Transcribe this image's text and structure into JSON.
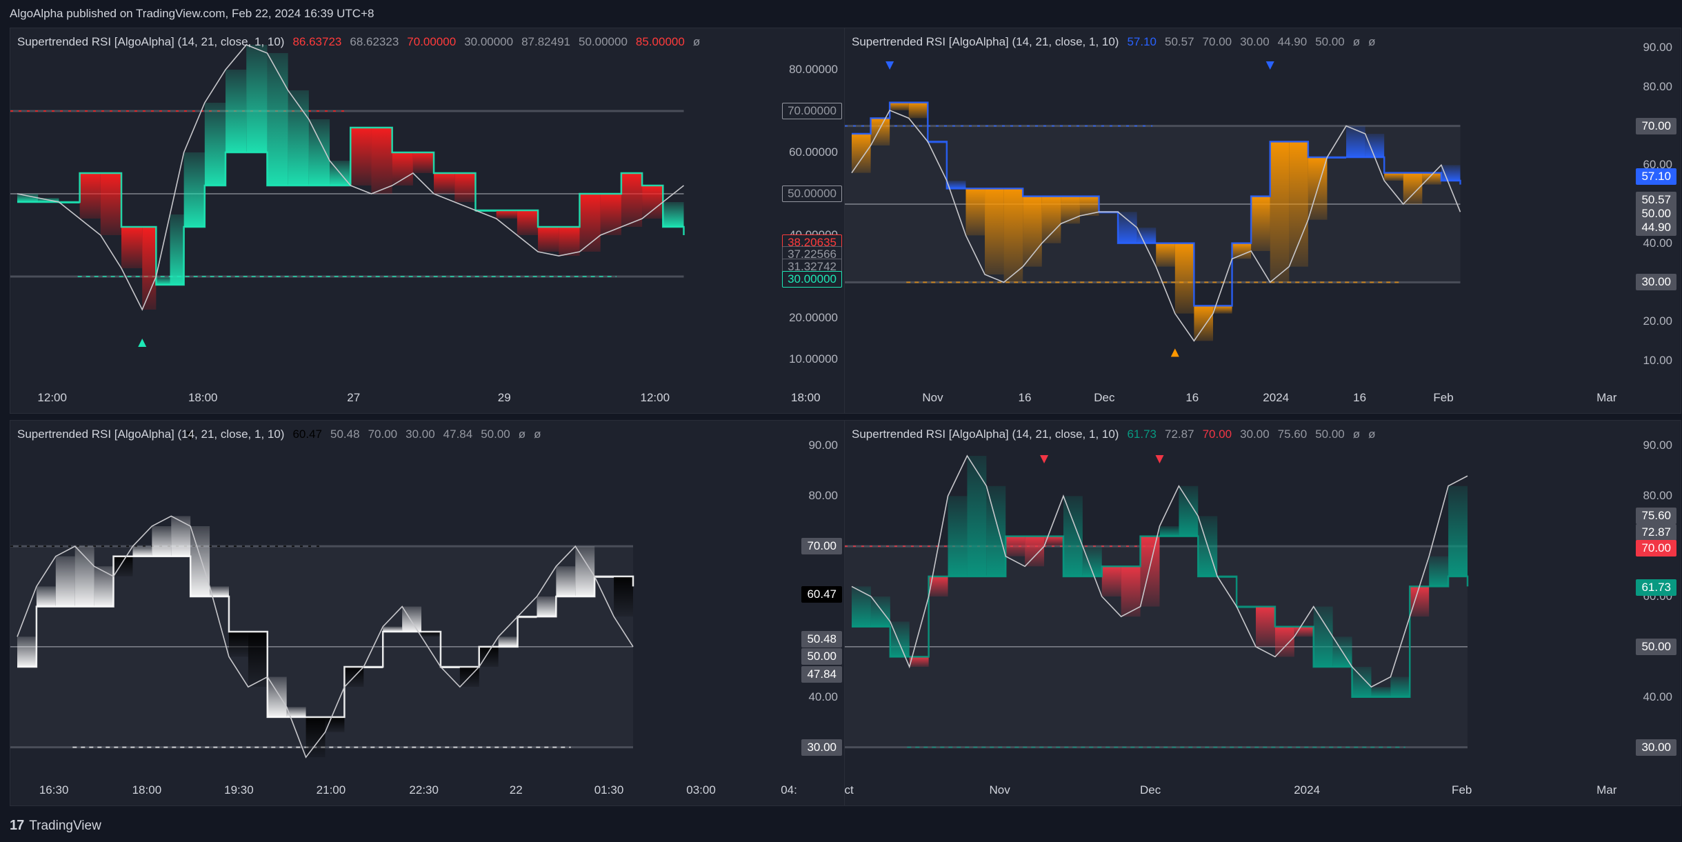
{
  "header": {
    "text": "AlgoAlpha published on TradingView.com, Feb 22, 2024 16:39 UTC+8"
  },
  "footer": {
    "brand": "TradingView",
    "logo_mark": "17"
  },
  "colors": {
    "bg": "#131722",
    "panel": "#1e222d",
    "teal": "#1de9b6",
    "red": "#ff1e1e",
    "blue": "#2962ff",
    "orange": "#ff9800",
    "white": "#ffffff",
    "crimson": "#f23645",
    "green": "#089981"
  },
  "panels": [
    {
      "id": "tl",
      "legend": [
        {
          "text": "Supertrended RSI [AlgoAlpha] (14, 21, close, 1, 10)",
          "color": "#d1d4dc"
        },
        {
          "text": "86.63723",
          "color": "#ff3b3b"
        },
        {
          "text": "68.62323",
          "color": "#9598a1"
        },
        {
          "text": "70.00000",
          "color": "#ff3b3b"
        },
        {
          "text": "30.00000",
          "color": "#9598a1"
        },
        {
          "text": "87.82491",
          "color": "#9598a1"
        },
        {
          "text": "50.00000",
          "color": "#9598a1"
        },
        {
          "text": "85.00000",
          "color": "#ff3b3b"
        },
        {
          "text": "ø",
          "color": "#9598a1"
        }
      ],
      "yticks": [
        "80.00000",
        "60.00000",
        "40.00000",
        "20.00000",
        "10.00000"
      ],
      "ytick_values": [
        80,
        60,
        40,
        20,
        10
      ],
      "badges": [
        {
          "text": "70.00000",
          "value": 70,
          "bg": "#1e222d",
          "fg": "#9598a1",
          "border": "#9598a1"
        },
        {
          "text": "50.00000",
          "value": 50,
          "bg": "#1e222d",
          "fg": "#9598a1",
          "border": "#9598a1"
        },
        {
          "text": "38.20635",
          "value": 38.2,
          "bg": "#1e222d",
          "fg": "#ff3b3b",
          "border": "#ff3b3b"
        },
        {
          "text": "37.22566",
          "value": 35.3,
          "bg": "#1e222d",
          "fg": "#9598a1",
          "border": "#5d606b"
        },
        {
          "text": "31.32742",
          "value": 32.4,
          "bg": "#1e222d",
          "fg": "#9598a1",
          "border": "#5d606b"
        },
        {
          "text": "30.00000",
          "value": 29.4,
          "bg": "#1e222d",
          "fg": "#1de9b6",
          "border": "#1de9b6"
        }
      ],
      "xticks": [
        "12:00",
        "18:00",
        "27",
        "29",
        "12:00",
        "18:00"
      ],
      "x_frac": [
        0.05,
        0.23,
        0.41,
        0.59,
        0.77,
        0.95
      ]
    },
    {
      "id": "tr",
      "legend": [
        {
          "text": "Supertrended RSI [AlgoAlpha] (14, 21, close, 1, 10)",
          "color": "#d1d4dc"
        },
        {
          "text": "57.10",
          "color": "#2962ff"
        },
        {
          "text": "50.57",
          "color": "#9598a1"
        },
        {
          "text": "70.00",
          "color": "#9598a1"
        },
        {
          "text": "30.00",
          "color": "#9598a1"
        },
        {
          "text": "44.90",
          "color": "#9598a1"
        },
        {
          "text": "50.00",
          "color": "#9598a1"
        },
        {
          "text": "ø",
          "color": "#9598a1"
        },
        {
          "text": "ø",
          "color": "#9598a1"
        }
      ],
      "yticks": [
        "90.00",
        "80.00",
        "60.00",
        "40.00",
        "20.00",
        "10.00"
      ],
      "ytick_values": [
        90,
        80,
        60,
        40,
        20,
        10
      ],
      "badges": [
        {
          "text": "70.00",
          "value": 70,
          "bg": "#50535e",
          "fg": "#ffffff",
          "border": "#50535e"
        },
        {
          "text": "57.10",
          "value": 57.1,
          "bg": "#2962ff",
          "fg": "#ffffff",
          "border": "#2962ff"
        },
        {
          "text": "50.57",
          "value": 51,
          "bg": "#50535e",
          "fg": "#ffffff",
          "border": "#50535e"
        },
        {
          "text": "50.00",
          "value": 47.5,
          "bg": "#50535e",
          "fg": "#ffffff",
          "border": "#50535e"
        },
        {
          "text": "44.90",
          "value": 44,
          "bg": "#50535e",
          "fg": "#ffffff",
          "border": "#50535e"
        },
        {
          "text": "30.00",
          "value": 30,
          "bg": "#50535e",
          "fg": "#ffffff",
          "border": "#50535e"
        }
      ],
      "xticks": [
        "Nov",
        "16",
        "Dec",
        "16",
        "2024",
        "16",
        "Feb",
        "Mar"
      ],
      "x_frac": [
        0.105,
        0.215,
        0.31,
        0.415,
        0.515,
        0.615,
        0.715,
        0.91
      ]
    },
    {
      "id": "bl",
      "legend": [
        {
          "text": "Supertrended RSI [AlgoAlpha] (14, 21, close, 1, 10)",
          "color": "#d1d4dc"
        },
        {
          "text": "60.47",
          "color": "#000000"
        },
        {
          "text": "50.48",
          "color": "#9598a1"
        },
        {
          "text": "70.00",
          "color": "#9598a1"
        },
        {
          "text": "30.00",
          "color": "#9598a1"
        },
        {
          "text": "47.84",
          "color": "#9598a1"
        },
        {
          "text": "50.00",
          "color": "#9598a1"
        },
        {
          "text": "ø",
          "color": "#9598a1"
        },
        {
          "text": "ø",
          "color": "#9598a1"
        }
      ],
      "yticks": [
        "90.00",
        "80.00",
        "40.00"
      ],
      "ytick_values": [
        90,
        80,
        40
      ],
      "badges": [
        {
          "text": "70.00",
          "value": 70,
          "bg": "#50535e",
          "fg": "#ffffff",
          "border": "#50535e"
        },
        {
          "text": "60.47",
          "value": 60.47,
          "bg": "#000000",
          "fg": "#ffffff",
          "border": "#000000"
        },
        {
          "text": "50.48",
          "value": 51.5,
          "bg": "#50535e",
          "fg": "#ffffff",
          "border": "#50535e"
        },
        {
          "text": "50.00",
          "value": 48,
          "bg": "#50535e",
          "fg": "#ffffff",
          "border": "#50535e"
        },
        {
          "text": "47.84",
          "value": 44.5,
          "bg": "#50535e",
          "fg": "#ffffff",
          "border": "#50535e"
        },
        {
          "text": "30.00",
          "value": 30,
          "bg": "#50535e",
          "fg": "#ffffff",
          "border": "#50535e"
        }
      ],
      "xticks": [
        "16:30",
        "18:00",
        "19:30",
        "21:00",
        "22:30",
        "22",
        "01:30",
        "03:00",
        "04:"
      ],
      "x_frac": [
        0.052,
        0.163,
        0.273,
        0.383,
        0.494,
        0.604,
        0.715,
        0.825,
        0.93
      ]
    },
    {
      "id": "br",
      "legend": [
        {
          "text": "Supertrended RSI [AlgoAlpha] (14, 21, close, 1, 10)",
          "color": "#d1d4dc"
        },
        {
          "text": "61.73",
          "color": "#089981"
        },
        {
          "text": "72.87",
          "color": "#9598a1"
        },
        {
          "text": "70.00",
          "color": "#f23645"
        },
        {
          "text": "30.00",
          "color": "#9598a1"
        },
        {
          "text": "75.60",
          "color": "#9598a1"
        },
        {
          "text": "50.00",
          "color": "#9598a1"
        },
        {
          "text": "ø",
          "color": "#9598a1"
        },
        {
          "text": "ø",
          "color": "#9598a1"
        }
      ],
      "yticks": [
        "90.00",
        "80.00",
        "60.00",
        "40.00"
      ],
      "ytick_values": [
        90,
        80,
        60,
        40
      ],
      "badges": [
        {
          "text": "75.60",
          "value": 76,
          "bg": "#50535e",
          "fg": "#ffffff",
          "border": "#50535e"
        },
        {
          "text": "72.87",
          "value": 72.8,
          "bg": "#50535e",
          "fg": "#ffffff",
          "border": "#50535e"
        },
        {
          "text": "70.00",
          "value": 69.6,
          "bg": "#f23645",
          "fg": "#ffffff",
          "border": "#f23645"
        },
        {
          "text": "61.73",
          "value": 61.73,
          "bg": "#089981",
          "fg": "#ffffff",
          "border": "#089981"
        },
        {
          "text": "50.00",
          "value": 50,
          "bg": "#50535e",
          "fg": "#ffffff",
          "border": "#50535e"
        },
        {
          "text": "30.00",
          "value": 30,
          "bg": "#50535e",
          "fg": "#ffffff",
          "border": "#50535e"
        }
      ],
      "xticks": [
        "ct",
        "Nov",
        "Dec",
        "2024",
        "Feb",
        "Mar"
      ],
      "x_frac": [
        0.005,
        0.185,
        0.365,
        0.552,
        0.737,
        0.91
      ]
    }
  ],
  "chart_data": [
    {
      "type": "area",
      "x": [
        0,
        3,
        6,
        9,
        12,
        15,
        18,
        20,
        22,
        24,
        27,
        30,
        33,
        36,
        39,
        42,
        45,
        48,
        51,
        54,
        57,
        60,
        63,
        66,
        69,
        72,
        75,
        78,
        81,
        84,
        87,
        90,
        93,
        96
      ],
      "series": [
        {
          "values": [
            50,
            49,
            48,
            44,
            40,
            32,
            22,
            30,
            45,
            60,
            72,
            80,
            86,
            84,
            75,
            68,
            58,
            52,
            50,
            52,
            55,
            50,
            48,
            46,
            44,
            40,
            36,
            35,
            36,
            40,
            42,
            44,
            48,
            52
          ]
        },
        {
          "values": [
            48,
            48,
            48,
            55,
            55,
            42,
            42,
            28,
            28,
            42,
            52,
            60,
            60,
            52,
            52,
            52,
            52,
            66,
            66,
            60,
            60,
            55,
            55,
            46,
            46,
            46,
            42,
            42,
            50,
            50,
            55,
            52,
            42,
            40
          ]
        }
      ],
      "ylim": [
        5,
        90
      ]
    },
    {
      "type": "area",
      "x": [
        0,
        3,
        6,
        9,
        12,
        15,
        18,
        21,
        24,
        27,
        30,
        33,
        36,
        39,
        42,
        45,
        48,
        51,
        54,
        57,
        60,
        63,
        66,
        69,
        72,
        75,
        78,
        81,
        84,
        87,
        90,
        93,
        96
      ],
      "series": [
        {
          "values": [
            58,
            65,
            74,
            72,
            66,
            56,
            42,
            32,
            30,
            34,
            40,
            45,
            47,
            48,
            48,
            44,
            34,
            22,
            15,
            22,
            36,
            38,
            30,
            34,
            46,
            62,
            70,
            68,
            56,
            50,
            55,
            60,
            48
          ]
        },
        {
          "values": [
            68,
            72,
            76,
            76,
            66,
            54,
            54,
            54,
            54,
            52,
            52,
            52,
            52,
            48,
            40,
            40,
            40,
            40,
            24,
            24,
            40,
            52,
            66,
            66,
            62,
            62,
            62,
            62,
            58,
            58,
            58,
            56,
            55
          ]
        }
      ],
      "ylim": [
        5,
        95
      ]
    },
    {
      "type": "area",
      "x": [
        0,
        3,
        6,
        9,
        12,
        15,
        18,
        21,
        24,
        27,
        30,
        33,
        36,
        39,
        42,
        45,
        48,
        51,
        54,
        57,
        60,
        63,
        66,
        69,
        72,
        75,
        78,
        81,
        84,
        87,
        90,
        93,
        96
      ],
      "series": [
        {
          "values": [
            52,
            62,
            68,
            70,
            66,
            64,
            70,
            74,
            76,
            74,
            62,
            48,
            42,
            44,
            38,
            28,
            33,
            42,
            46,
            54,
            58,
            52,
            46,
            42,
            46,
            52,
            56,
            60,
            66,
            70,
            64,
            56,
            50
          ]
        },
        {
          "values": [
            46,
            58,
            58,
            58,
            58,
            68,
            68,
            68,
            68,
            60,
            60,
            53,
            53,
            36,
            36,
            36,
            36,
            46,
            46,
            53,
            53,
            53,
            46,
            46,
            50,
            50,
            56,
            56,
            60,
            60,
            64,
            64,
            62
          ]
        }
      ],
      "ylim": [
        25,
        95
      ]
    },
    {
      "type": "area",
      "x": [
        0,
        3,
        6,
        9,
        12,
        15,
        18,
        21,
        24,
        27,
        30,
        33,
        36,
        39,
        42,
        45,
        48,
        51,
        54,
        57,
        60,
        63,
        66,
        69,
        72,
        75,
        78,
        81,
        84,
        87,
        90,
        93,
        96
      ],
      "series": [
        {
          "values": [
            62,
            60,
            55,
            46,
            60,
            80,
            88,
            82,
            68,
            66,
            70,
            80,
            70,
            60,
            56,
            58,
            74,
            82,
            76,
            64,
            58,
            50,
            48,
            52,
            58,
            52,
            46,
            42,
            44,
            56,
            68,
            82,
            84
          ]
        },
        {
          "values": [
            54,
            54,
            48,
            48,
            64,
            64,
            64,
            64,
            72,
            72,
            72,
            64,
            64,
            66,
            66,
            72,
            72,
            72,
            64,
            64,
            58,
            58,
            54,
            54,
            46,
            46,
            40,
            40,
            40,
            62,
            62,
            64,
            62
          ]
        }
      ],
      "ylim": [
        25,
        95
      ]
    }
  ]
}
